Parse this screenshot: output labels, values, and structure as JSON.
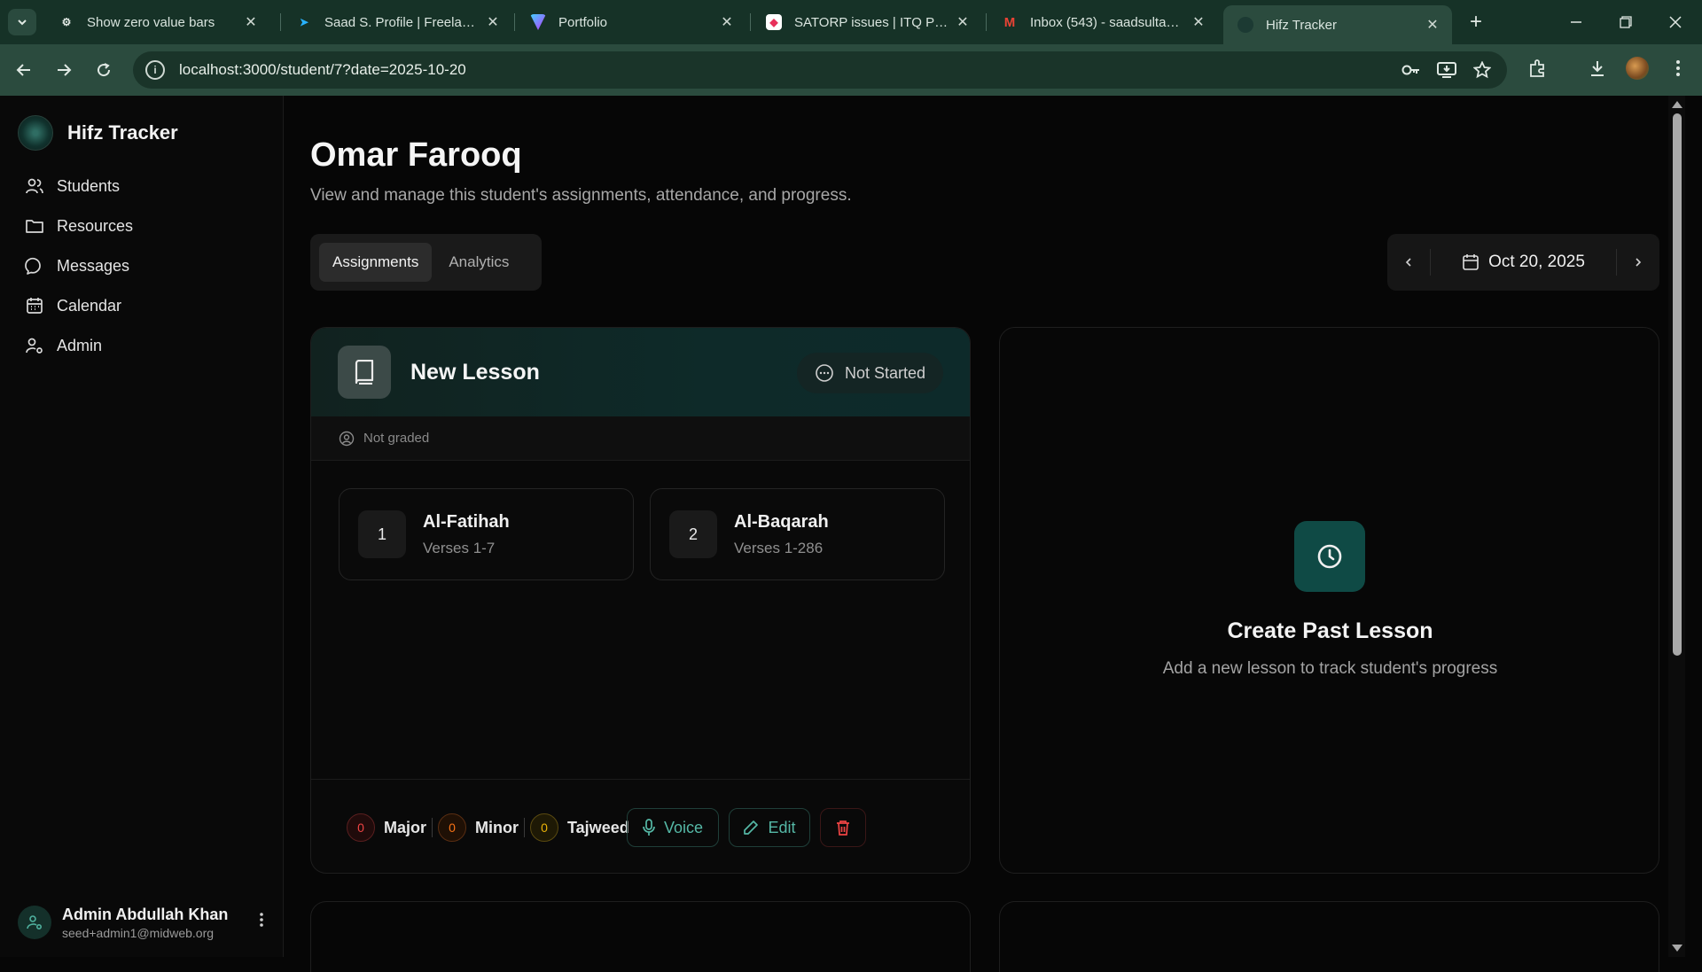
{
  "browser": {
    "tabs": [
      {
        "title": "Show zero value bars",
        "close": "✕"
      },
      {
        "title": "Saad S. Profile | Freelancer",
        "close": "✕"
      },
      {
        "title": "Portfolio",
        "close": "✕"
      },
      {
        "title": "SATORP issues | ITQ Plus (U",
        "close": "✕"
      },
      {
        "title": "Inbox (543) - saadsultan40",
        "close": "✕"
      },
      {
        "title": "Hifz Tracker",
        "close": "✕"
      }
    ],
    "url": "localhost:3000/student/7?date=2025-10-20"
  },
  "sidebar": {
    "brand": "Hifz Tracker",
    "items": [
      {
        "label": "Students"
      },
      {
        "label": "Resources"
      },
      {
        "label": "Messages"
      },
      {
        "label": "Calendar"
      },
      {
        "label": "Admin"
      }
    ],
    "user": {
      "name": "Admin Abdullah Khan",
      "email": "seed+admin1@midweb.org"
    }
  },
  "page": {
    "title": "Omar Farooq",
    "subtitle": "View and manage this student's assignments, attendance, and progress.",
    "tabs": [
      {
        "label": "Assignments"
      },
      {
        "label": "Analytics"
      }
    ],
    "date": "Oct 20, 2025"
  },
  "lesson": {
    "title": "New Lesson",
    "status": "Not Started",
    "grade": "Not graded",
    "surahs": [
      {
        "number": "1",
        "name": "Al-Fatihah",
        "verses": "Verses 1-7"
      },
      {
        "number": "2",
        "name": "Al-Baqarah",
        "verses": "Verses 1-286"
      }
    ],
    "mistakes": [
      {
        "count": "0",
        "label": "Major",
        "color": "#ef4444"
      },
      {
        "count": "0",
        "label": "Minor",
        "color": "#f97316"
      },
      {
        "count": "0",
        "label": "Tajweed",
        "color": "#eab308"
      }
    ],
    "actions": {
      "voice": "Voice",
      "edit": "Edit"
    }
  },
  "past_lesson": {
    "title": "Create Past Lesson",
    "subtitle": "Add a new lesson to track student's progress"
  },
  "colors": {
    "accent": "#55b8a6",
    "danger": "#ef4444"
  }
}
